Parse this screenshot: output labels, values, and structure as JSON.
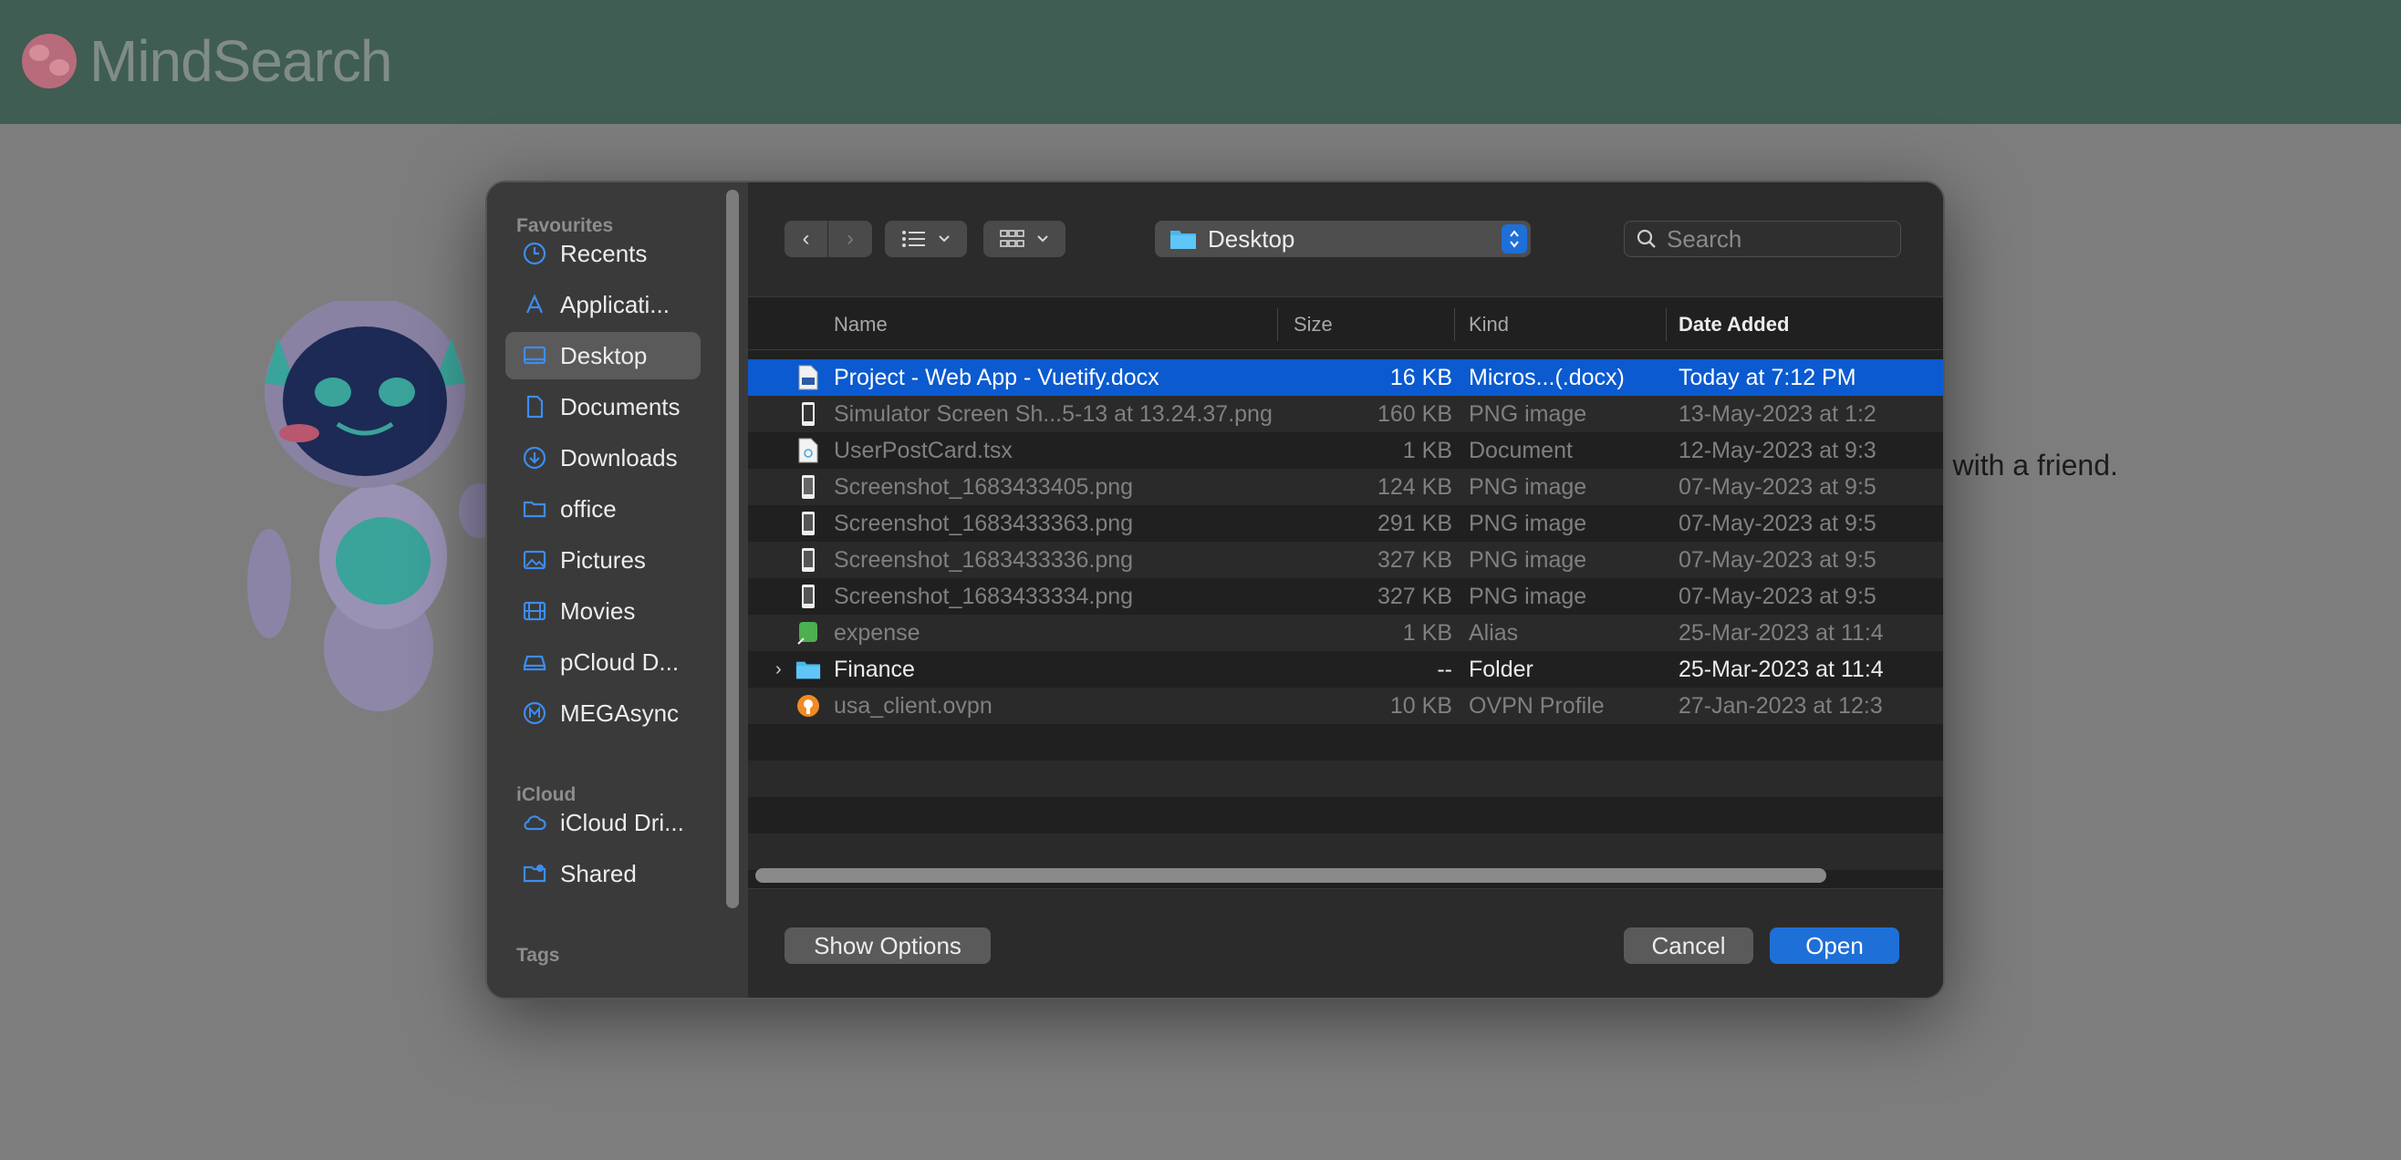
{
  "app": {
    "title": "MindSearch",
    "background_text": "ting with a friend."
  },
  "sidebar": {
    "favourites_label": "Favourites",
    "favourites": [
      {
        "label": "Recents",
        "icon": "clock-icon"
      },
      {
        "label": "Applicati...",
        "icon": "applications-icon"
      },
      {
        "label": "Desktop",
        "icon": "desktop-icon",
        "active": true
      },
      {
        "label": "Documents",
        "icon": "document-icon"
      },
      {
        "label": "Downloads",
        "icon": "download-icon"
      },
      {
        "label": "office",
        "icon": "folder-icon"
      },
      {
        "label": "Pictures",
        "icon": "pictures-icon"
      },
      {
        "label": "Movies",
        "icon": "movies-icon"
      },
      {
        "label": "pCloud D...",
        "icon": "drive-icon"
      },
      {
        "label": "MEGAsync",
        "icon": "mega-icon"
      }
    ],
    "icloud_label": "iCloud",
    "icloud": [
      {
        "label": "iCloud Dri...",
        "icon": "cloud-icon"
      },
      {
        "label": "Shared",
        "icon": "shared-folder-icon"
      }
    ],
    "tags_label": "Tags"
  },
  "toolbar": {
    "location": "Desktop",
    "search_placeholder": "Search"
  },
  "columns": {
    "name": "Name",
    "size": "Size",
    "kind": "Kind",
    "date": "Date Added"
  },
  "files": [
    {
      "name": "Project - Web App - Vuetify.docx",
      "size": "16 KB",
      "kind": "Micros...(.docx)",
      "date": "Today at 7:12 PM",
      "icon": "docx-file-icon",
      "selected": true,
      "enabled": true
    },
    {
      "name": "Simulator Screen Sh...5-13 at 13.24.37.png",
      "size": "160 KB",
      "kind": "PNG image",
      "date": "13-May-2023 at 1:2",
      "icon": "image-file-icon"
    },
    {
      "name": "UserPostCard.tsx",
      "size": "1 KB",
      "kind": "Document",
      "date": "12-May-2023 at 9:3",
      "icon": "code-file-icon"
    },
    {
      "name": "Screenshot_1683433405.png",
      "size": "124 KB",
      "kind": "PNG image",
      "date": "07-May-2023 at 9:5",
      "icon": "image-file-icon"
    },
    {
      "name": "Screenshot_1683433363.png",
      "size": "291 KB",
      "kind": "PNG image",
      "date": "07-May-2023 at 9:5",
      "icon": "image-file-icon"
    },
    {
      "name": "Screenshot_1683433336.png",
      "size": "327 KB",
      "kind": "PNG image",
      "date": "07-May-2023 at 9:5",
      "icon": "image-file-icon"
    },
    {
      "name": "Screenshot_1683433334.png",
      "size": "327 KB",
      "kind": "PNG image",
      "date": "07-May-2023 at 9:5",
      "icon": "image-file-icon"
    },
    {
      "name": "expense",
      "size": "1 KB",
      "kind": "Alias",
      "date": "25-Mar-2023 at 11:4",
      "icon": "alias-file-icon"
    },
    {
      "name": "Finance",
      "size": "--",
      "kind": "Folder",
      "date": "25-Mar-2023 at 11:4",
      "icon": "folder-icon",
      "enabled": true,
      "folder": true
    },
    {
      "name": "usa_client.ovpn",
      "size": "10 KB",
      "kind": "OVPN Profile",
      "date": "27-Jan-2023 at 12:3",
      "icon": "vpn-file-icon"
    }
  ],
  "buttons": {
    "show_options": "Show Options",
    "cancel": "Cancel",
    "open": "Open"
  },
  "colors": {
    "accent": "#1f6fd8",
    "selection": "#0b5ad0",
    "header": "#3f5d52"
  }
}
